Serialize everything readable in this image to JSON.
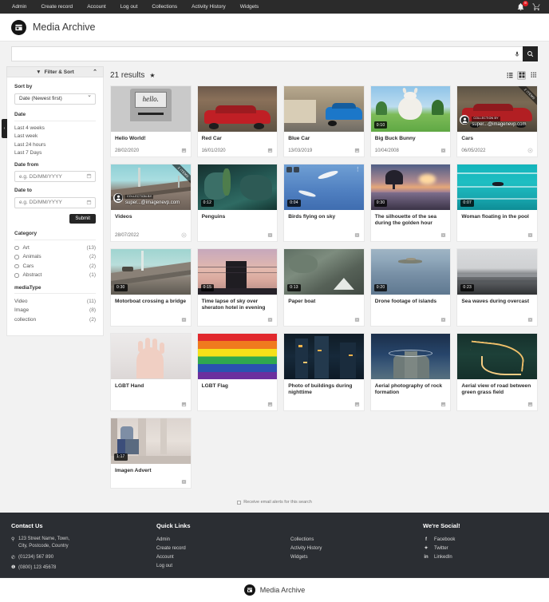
{
  "topnav": {
    "items": [
      "Admin",
      "Create record",
      "Account",
      "Log out",
      "Collections",
      "Activity History",
      "Widgets"
    ],
    "notification_count": "8",
    "bell_icon": "bell-icon",
    "cart_icon": "cart-icon"
  },
  "header": {
    "title": "Media Archive",
    "logo_icon": "clapperboard-icon"
  },
  "search": {
    "value": "",
    "placeholder": "",
    "mic_icon": "microphone-icon",
    "search_icon": "search-icon"
  },
  "sidebar": {
    "filter_title": "Filter & Sort",
    "filter_icon": "funnel-icon",
    "collapse_icon": "chevron-up-icon",
    "sort_label": "Sort by",
    "sort_value": "Date (Newest first)",
    "date_label": "Date",
    "date_links": [
      "Last 4 weeks",
      "Last week",
      "Last 24 hours",
      "Last 7 Days"
    ],
    "date_from_label": "Date from",
    "date_from_placeholder": "e.g. DD/MM/YYYY",
    "date_to_label": "Date to",
    "date_to_placeholder": "e.g. DD/MM/YYYY",
    "submit_label": "Submit",
    "category_label": "Category",
    "categories": [
      {
        "label": "Art",
        "count": "(13)"
      },
      {
        "label": "Animals",
        "count": "(2)"
      },
      {
        "label": "Cars",
        "count": "(2)"
      },
      {
        "label": "Abstract",
        "count": "(1)"
      }
    ],
    "mediatype_label": "mediaType",
    "mediatypes": [
      {
        "label": "Video",
        "count": "(11)"
      },
      {
        "label": "Image",
        "count": "(8)"
      },
      {
        "label": "collection",
        "count": "(2)"
      }
    ]
  },
  "results": {
    "count_label": "21 results",
    "star_icon": "star-icon",
    "views": [
      "list-view-icon",
      "grid-view-icon",
      "compact-view-icon"
    ],
    "active_view": "grid-view-icon",
    "alerts_label": "Receive email alerts for this search",
    "items": [
      {
        "title": "Hello World!",
        "date": "28/02/2020",
        "type": "image",
        "duration": "",
        "collection": null
      },
      {
        "title": "Red Car",
        "date": "16/01/2020",
        "type": "image",
        "duration": "",
        "collection": null
      },
      {
        "title": "Blue Car",
        "date": "13/03/2019",
        "type": "image",
        "duration": "",
        "collection": null
      },
      {
        "title": "Big Buck Bunny",
        "date": "10/04/2008",
        "type": "video",
        "duration": "0:10",
        "collection": null
      },
      {
        "title": "Cars",
        "date": "06/05/2022",
        "type": "collection",
        "duration": "",
        "collection": {
          "ribbon": "2 ITEMS",
          "by_label": "COLLECTION BY",
          "owner": "super...@imagenevp.com"
        }
      },
      {
        "title": "Videos",
        "date": "28/07/2022",
        "type": "collection",
        "duration": "",
        "collection": {
          "ribbon": "2 ITEMS",
          "by_label": "COLLECTION BY",
          "owner": "super...@imagenevp.com"
        }
      },
      {
        "title": "Penguins",
        "date": "",
        "type": "video",
        "duration": "0:12",
        "collection": null
      },
      {
        "title": "Birds flying on sky",
        "date": "",
        "type": "video",
        "duration": "0:04",
        "collection": null
      },
      {
        "title": "The silhouette of the sea during the golden hour",
        "date": "",
        "type": "video",
        "duration": "0:30",
        "collection": null
      },
      {
        "title": "Woman floating in the pool",
        "date": "",
        "type": "video",
        "duration": "0:07",
        "collection": null
      },
      {
        "title": "Motorboat crossing a bridge",
        "date": "",
        "type": "video",
        "duration": "0:30",
        "collection": null
      },
      {
        "title": "Time lapse of sky over sheraton hotel in evening",
        "date": "",
        "type": "video",
        "duration": "0:15",
        "collection": null
      },
      {
        "title": "Paper boat",
        "date": "",
        "type": "video",
        "duration": "0:13",
        "collection": null
      },
      {
        "title": "Drone footage of islands",
        "date": "",
        "type": "video",
        "duration": "0:20",
        "collection": null
      },
      {
        "title": "Sea waves during overcast",
        "date": "",
        "type": "video",
        "duration": "0:23",
        "collection": null
      },
      {
        "title": "LGBT Hand",
        "date": "",
        "type": "image",
        "duration": "",
        "collection": null
      },
      {
        "title": "LGBT Flag",
        "date": "",
        "type": "image",
        "duration": "",
        "collection": null
      },
      {
        "title": "Photo of buildings during nighttime",
        "date": "",
        "type": "image",
        "duration": "",
        "collection": null
      },
      {
        "title": "Aerial photography of rock formation",
        "date": "",
        "type": "image",
        "duration": "",
        "collection": null
      },
      {
        "title": "Aerial view of road between green grass field",
        "date": "",
        "type": "image",
        "duration": "",
        "collection": null
      },
      {
        "title": "Imagen Advert",
        "date": "",
        "type": "video",
        "duration": "1:17",
        "collection": null
      }
    ]
  },
  "footer": {
    "contact_head": "Contact Us",
    "address_line1": "123 Street Name, Town,",
    "address_line2": "City, Postcode, Country",
    "phone1": "(01234) 567 890",
    "phone2": "(0800) 123 45678",
    "quick_head": "Quick Links",
    "quick_col1": [
      "Admin",
      "Create record",
      "Account",
      "Log out"
    ],
    "quick_col2": [
      "Collections",
      "Activity History",
      "Widgets"
    ],
    "social_head": "We're Social!",
    "socials": [
      {
        "icon": "facebook-icon",
        "glyph": "f",
        "label": "Facebook"
      },
      {
        "icon": "twitter-icon",
        "glyph": "✦",
        "label": "Twitter"
      },
      {
        "icon": "linkedin-icon",
        "glyph": "in",
        "label": "LinkedIn"
      }
    ]
  },
  "bottombar": {
    "title": "Media Archive",
    "logo_icon": "clapperboard-icon"
  }
}
